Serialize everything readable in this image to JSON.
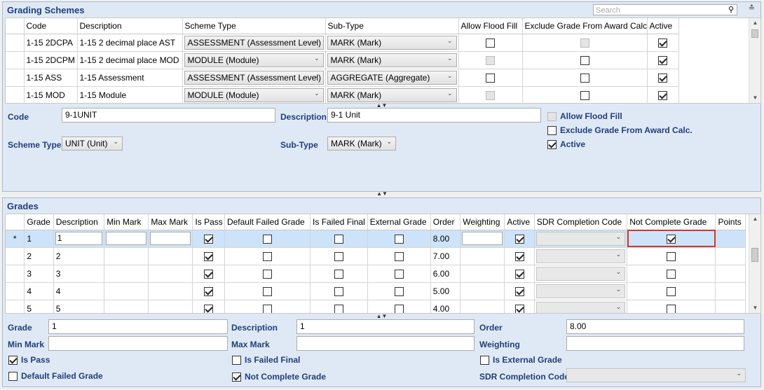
{
  "schemes": {
    "title": "Grading Schemes",
    "search_placeholder": "Search",
    "columns": [
      "Code",
      "Description",
      "Scheme Type",
      "Sub-Type",
      "Allow Flood Fill",
      "Exclude Grade From Award Calc.",
      "Active"
    ],
    "rows": [
      {
        "code": "1-15 2DCPA",
        "desc": "1-15 2 decimal place AST",
        "type": "ASSESSMENT (Assessment Level)",
        "sub": "MARK (Mark)",
        "flood": "off",
        "exclude": "dis",
        "active": "on"
      },
      {
        "code": "1-15 2DCPM",
        "desc": "1-15 2 decimal place MOD",
        "type": "MODULE (Module)",
        "sub": "MARK (Mark)",
        "flood": "dis",
        "exclude": "off",
        "active": "on"
      },
      {
        "code": "1-15 ASS",
        "desc": "1-15 Assessment",
        "type": "ASSESSMENT (Assessment Level)",
        "sub": "AGGREGATE (Aggregate)",
        "flood": "off",
        "exclude": "off",
        "active": "on"
      },
      {
        "code": "1-15 MOD",
        "desc": "1-15 Module",
        "type": "MODULE (Module)",
        "sub": "MARK (Mark)",
        "flood": "dis",
        "exclude": "off",
        "active": "on"
      }
    ],
    "detail": {
      "code_label": "Code",
      "code_value": "9-1UNIT",
      "desc_label": "Description",
      "desc_value": "9-1 Unit",
      "type_label": "Scheme Type",
      "type_value": "UNIT (Unit)",
      "sub_label": "Sub-Type",
      "sub_value": "MARK (Mark)",
      "flood_label": "Allow Flood Fill",
      "exclude_label": "Exclude Grade From Award Calc.",
      "active_label": "Active"
    }
  },
  "grades": {
    "title": "Grades",
    "columns": [
      "Grade",
      "Description",
      "Min Mark",
      "Max Mark",
      "Is Pass",
      "Default Failed Grade",
      "Is Failed Final",
      "External Grade",
      "Order",
      "Weighting",
      "Active",
      "SDR Completion Code",
      "Not Complete Grade",
      "Points"
    ],
    "new_row_marker": "*",
    "rows": [
      {
        "grade": "1",
        "desc": "1",
        "pass": "on",
        "order": "8.00",
        "active": "on",
        "notcomplete": "on"
      },
      {
        "grade": "2",
        "desc": "2",
        "pass": "on",
        "order": "7.00",
        "active": "on",
        "notcomplete": "off"
      },
      {
        "grade": "3",
        "desc": "3",
        "pass": "on",
        "order": "6.00",
        "active": "on",
        "notcomplete": "off"
      },
      {
        "grade": "4",
        "desc": "4",
        "pass": "on",
        "order": "5.00",
        "active": "on",
        "notcomplete": "off"
      },
      {
        "grade": "5",
        "desc": "5",
        "pass": "on",
        "order": "4.00",
        "active": "on",
        "notcomplete": "off"
      }
    ],
    "detail": {
      "grade_label": "Grade",
      "grade_value": "1",
      "desc_label": "Description",
      "desc_value": "1",
      "order_label": "Order",
      "order_value": "8.00",
      "min_label": "Min Mark",
      "max_label": "Max Mark",
      "weight_label": "Weighting",
      "ispass_label": "Is Pass",
      "failedfinal_label": "Is Failed Final",
      "external_label": "Is External Grade",
      "defaultfailed_label": "Default Failed Grade",
      "notcomplete_label": "Not Complete Grade",
      "sdr_label": "SDR Completion Code"
    }
  },
  "colors": {
    "title": "#1f3e7a",
    "highlight": "#d9342b",
    "selected_row": "#cde3fa"
  }
}
